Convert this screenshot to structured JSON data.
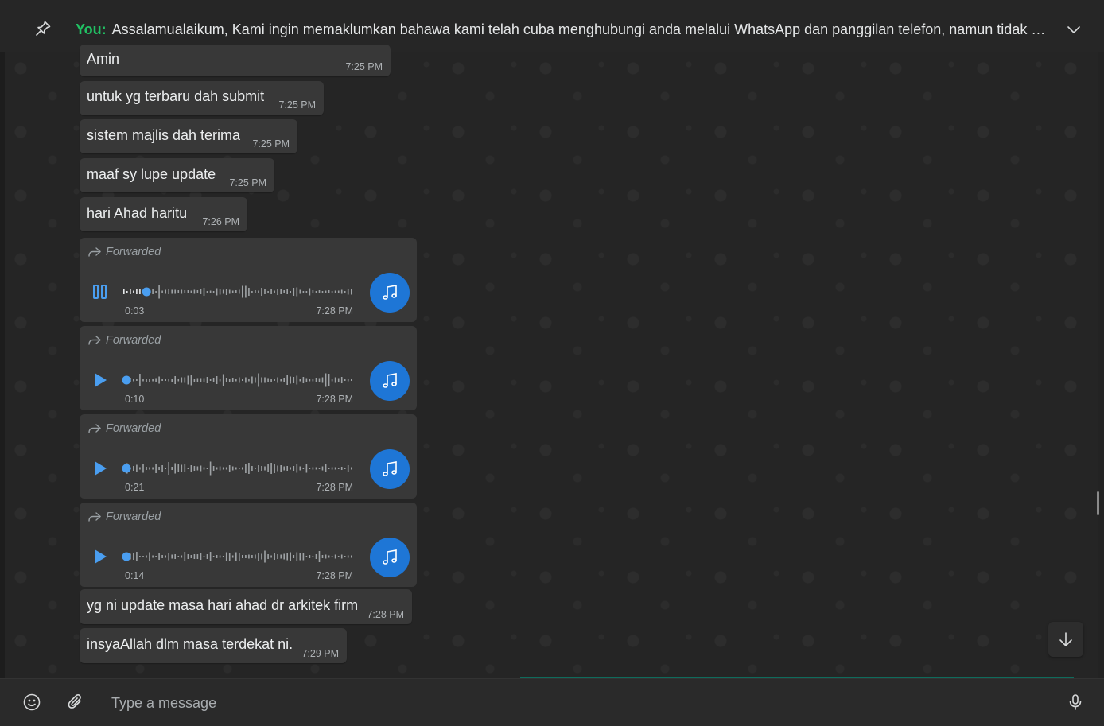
{
  "pinned": {
    "sender": "You:",
    "text": "Assalamualaikum,  Kami ingin memaklumkan bahawa kami telah cuba menghubungi anda melalui WhatsApp dan panggilan telefon, namun tidak menerima maklum balas"
  },
  "messages": [
    {
      "text": "Amin",
      "time": "7:25 PM"
    },
    {
      "text": "untuk yg terbaru dah submit",
      "time": "7:25 PM"
    },
    {
      "text": "sistem majlis dah terima",
      "time": "7:25 PM"
    },
    {
      "text": "maaf sy lupe update",
      "time": "7:25 PM"
    },
    {
      "text": "hari Ahad haritu",
      "time": "7:26 PM"
    }
  ],
  "audio_messages": [
    {
      "label": "Forwarded",
      "duration": "0:03",
      "time": "7:28 PM",
      "state": "playing",
      "progress": 0.09
    },
    {
      "label": "Forwarded",
      "duration": "0:10",
      "time": "7:28 PM",
      "state": "paused",
      "progress": 0
    },
    {
      "label": "Forwarded",
      "duration": "0:21",
      "time": "7:28 PM",
      "state": "paused",
      "progress": 0
    },
    {
      "label": "Forwarded",
      "duration": "0:14",
      "time": "7:28 PM",
      "state": "paused",
      "progress": 0
    }
  ],
  "messages_after": [
    {
      "text": "yg ni update masa hari ahad dr arkitek firm",
      "time": "7:28 PM"
    },
    {
      "text": "insyaAllah dlm masa terdekat ni.",
      "time": "7:29 PM"
    }
  ],
  "composer": {
    "placeholder": "Type a message"
  },
  "colors": {
    "accent_green": "#21c063",
    "audio_blue": "#1e76d6",
    "bubble": "#383838",
    "background": "#252525"
  },
  "icons": [
    "pin-icon",
    "chevron-down-icon",
    "forward-icon",
    "play-icon",
    "pause-icon",
    "music-note-icon",
    "arrow-down-icon",
    "emoji-icon",
    "attach-icon",
    "mic-icon"
  ]
}
